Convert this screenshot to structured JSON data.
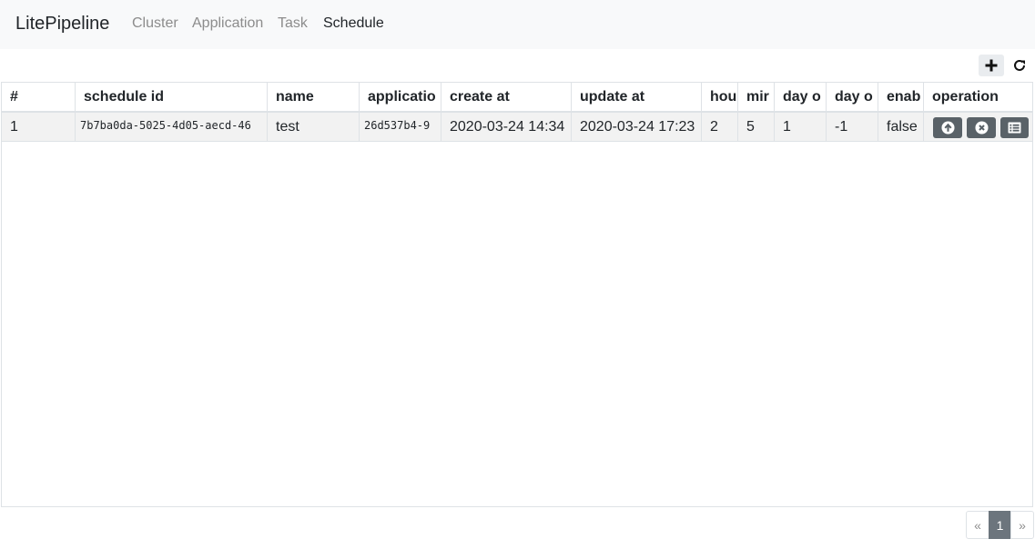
{
  "nav": {
    "brand": "LitePipeline",
    "links": [
      "Cluster",
      "Application",
      "Task",
      "Schedule"
    ],
    "active": "Schedule"
  },
  "toolbar": {
    "add_icon": "plus-icon",
    "refresh_icon": "refresh-icon"
  },
  "table": {
    "headers": [
      "#",
      "schedule id",
      "name",
      "applicatio",
      "create at",
      "update at",
      "hou",
      "mir",
      "day o",
      "day o",
      "enab",
      "operation"
    ],
    "rows": [
      {
        "num": "1",
        "schedule_id": "7b7ba0da-5025-4d05-aecd-46",
        "name": "test",
        "application": "26d537b4-9",
        "create_at": "2020-03-24 14:34",
        "update_at": "2020-03-24 17:23",
        "hour": "2",
        "minute": "5",
        "day_of_month": "1",
        "day_of_week": "-1",
        "enable": "false",
        "operations": [
          "arrow-up-circle-icon",
          "x-circle-icon",
          "list-icon"
        ]
      }
    ]
  },
  "pagination": {
    "prev": "«",
    "current": "1",
    "next": "»"
  },
  "colors": {
    "nav_bg": "#f8f9fa",
    "button_secondary": "#5a6268",
    "stripe": "#f2f2f2",
    "border": "#dee2e6"
  }
}
